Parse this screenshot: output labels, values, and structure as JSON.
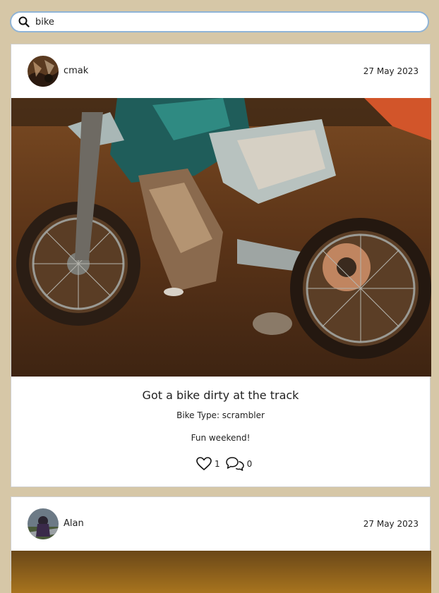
{
  "search": {
    "value": "bike",
    "icon": "search-icon"
  },
  "posts": [
    {
      "author": "cmak",
      "date": "27 May 2023",
      "title": "Got a bike dirty at the track",
      "bike_type": "Bike Type: scrambler",
      "content": "Fun weekend!",
      "likes": "1",
      "comments": "0",
      "image_desc": "muddy dirt bike"
    },
    {
      "author": "Alan",
      "date": "27 May 2023"
    }
  ],
  "colors": {
    "page_bg": "#d6c7a7",
    "search_border": "#90b4d6",
    "card_bg": "#ffffff"
  }
}
